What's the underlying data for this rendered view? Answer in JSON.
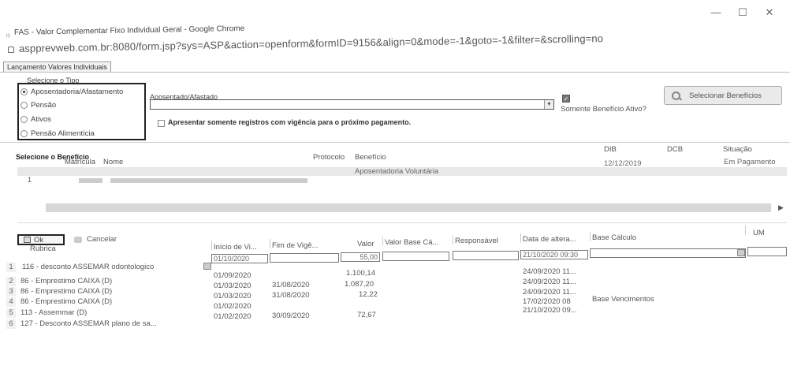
{
  "window": {
    "title": "FAS - Valor Complementar Fixo Individual Geral - Google Chrome",
    "url": "aspprevweb.com.br:8080/form.jsp?sys=ASP&action=openform&formID=9156&align=0&mode=-1&goto=-1&filter=&scrolling=no",
    "controls": [
      "—",
      "☐",
      "✕"
    ]
  },
  "tab": {
    "label": "Lançamento Valores Individuais"
  },
  "tipo": {
    "legend": "Selecione o Tipo",
    "options": [
      {
        "label": "Aposentadoria/Afastamento",
        "selected": true
      },
      {
        "label": "Pensão",
        "selected": false
      },
      {
        "label": "Ativos",
        "selected": false
      },
      {
        "label": "Pensão Alimentícia",
        "selected": false
      }
    ],
    "field_label": "Aposentado/Afastado",
    "somente_ativo_label": "Somente Benefício Ativo?",
    "somente_ativo_checked": true,
    "vigencia_label": "Apresentar somente registros com vigência para o próximo pagamento.",
    "select_button": "Selecionar Benefícios"
  },
  "beneficio": {
    "title": "Selecione o Benefício",
    "columns": [
      "Matrícula",
      "Nome",
      "Protocolo",
      "Benefício",
      "DIB",
      "DCB",
      "Situação"
    ],
    "rows": [
      {
        "num": "1",
        "beneficio": "Aposentadoria Voluntária",
        "dib": "12/12/2019",
        "situacao": "Em Pagamento"
      }
    ]
  },
  "actions": {
    "ok": "Ok",
    "cancel": "Cancelar"
  },
  "rubricas": {
    "columns": [
      "Rubrica",
      "Início de Vi...",
      "Fim de Vigê...",
      "Valor",
      "Valor Base Cá...",
      "Responsável",
      "Data de altera...",
      "Base Cálculo",
      "UM"
    ],
    "edit_row": {
      "inicio": "01/10/2020",
      "valor": "55,00",
      "data": "21/10/2020 09:30"
    },
    "rows": [
      {
        "num": "1",
        "rubrica": "116 - desconto ASSEMAR odontologico",
        "inicio": "01/09/2020",
        "fim": "",
        "valor": "1.100,14",
        "data": "24/09/2020 11...",
        "base": ""
      },
      {
        "num": "2",
        "rubrica": "86 - Emprestimo CAIXA (D)",
        "inicio": "01/03/2020",
        "fim": "31/08/2020",
        "valor": "1.087,20",
        "data": "24/09/2020 11...",
        "base": ""
      },
      {
        "num": "3",
        "rubrica": "86 - Emprestimo CAIXA (D)",
        "inicio": "01/03/2020",
        "fim": "31/08/2020",
        "valor": "12,22",
        "data": "24/09/2020 11...",
        "base": ""
      },
      {
        "num": "4",
        "rubrica": "86 - Emprestimo CAIXA (D)",
        "inicio": "01/02/2020",
        "fim": "",
        "valor": "",
        "data": "17/02/2020 08",
        "base": "Base Vencimentos"
      },
      {
        "num": "5",
        "rubrica": "113 - Assemmar (D)",
        "inicio": "01/02/2020",
        "fim": "30/09/2020",
        "valor": "72,67",
        "data": "21/10/2020 09...",
        "base": ""
      },
      {
        "num": "6",
        "rubrica": "127 - Desconto ASSEMAR plano de sa...",
        "inicio": "",
        "fim": "",
        "valor": "",
        "data": "",
        "base": ""
      }
    ]
  }
}
